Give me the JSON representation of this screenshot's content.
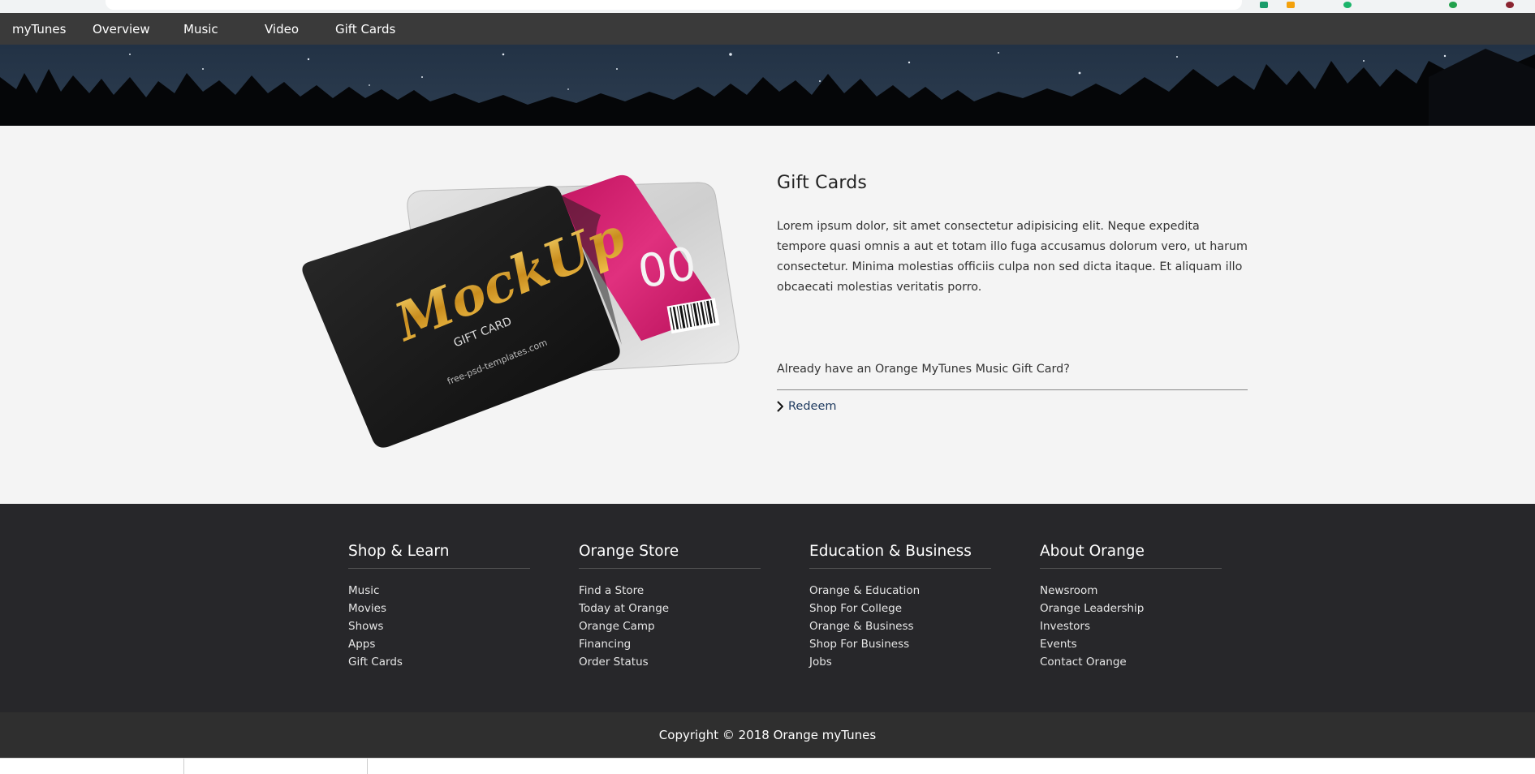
{
  "nav": {
    "brand": "myTunes",
    "items": [
      "Overview",
      "Music",
      "Video",
      "Gift Cards"
    ]
  },
  "giftcard": {
    "title": "Gift Cards",
    "description": "Lorem ipsum dolor, sit amet consectetur adipisicing elit. Neque expedita tempore quasi omnis a aut et totam illo fuga accusamus dolorum vero, ut harum consectetur. Minima molestias officiis culpa non sed dicta itaque. Et aliquam illo obcaecati molestias veritatis porro.",
    "question": "Already have an Orange MyTunes Music Gift Card?",
    "redeem_label": "Redeem",
    "image": {
      "brand_text": "MockUp",
      "subtitle": "GIFT CARD",
      "site": "free-psd-templates.com",
      "value_text": "00"
    }
  },
  "footer": {
    "columns": [
      {
        "title": "Shop & Learn",
        "links": [
          "Music",
          "Movies",
          "Shows",
          "Apps",
          "Gift Cards"
        ]
      },
      {
        "title": "Orange Store",
        "links": [
          "Find a Store",
          "Today at Orange",
          "Orange Camp",
          "Financing",
          "Order Status"
        ]
      },
      {
        "title": "Education & Business",
        "links": [
          "Orange & Education",
          "Shop For College",
          "Orange & Business",
          "Shop For Business",
          "Jobs"
        ]
      },
      {
        "title": "About Orange",
        "links": [
          "Newsroom",
          "Orange Leadership",
          "Investors",
          "Events",
          "Contact Orange"
        ]
      }
    ],
    "copyright": "Copyright © 2018 Orange myTunes"
  },
  "colors": {
    "nav_bg": "#3a3a3a",
    "footer_bg": "#27272a",
    "copyright_bg": "#2f2f2f",
    "accent_pink": "#d21e6e",
    "link_blue": "#1e3a5f"
  }
}
